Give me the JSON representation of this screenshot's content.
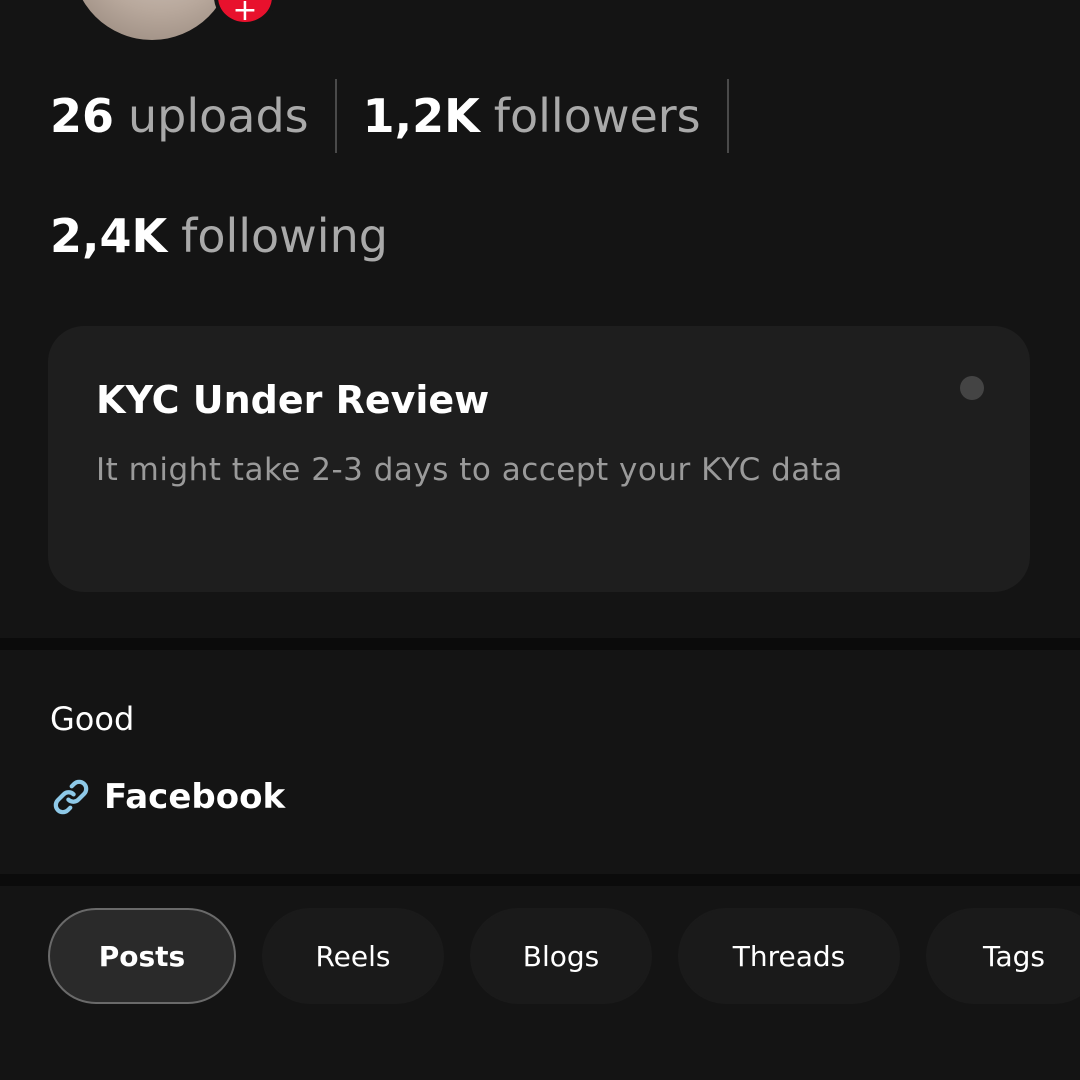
{
  "stats": {
    "uploads": {
      "value": "26",
      "label": "uploads"
    },
    "followers": {
      "value": "1,2K",
      "label": "followers"
    },
    "following": {
      "value": "2,4K",
      "label": "following"
    }
  },
  "kyc": {
    "title": "KYC Under Review",
    "description": "It might take 2-3 days to accept your KYC data"
  },
  "bio": {
    "text": "Good",
    "link_label": "Facebook",
    "link_icon": "link-icon"
  },
  "tabs": [
    {
      "label": "Posts",
      "active": true
    },
    {
      "label": "Reels",
      "active": false
    },
    {
      "label": "Blogs",
      "active": false
    },
    {
      "label": "Threads",
      "active": false
    },
    {
      "label": "Tags",
      "active": false
    }
  ],
  "colors": {
    "background": "#141414",
    "card": "#1e1e1e",
    "badge": "#e8112d",
    "muted_text": "#a9a9a9",
    "link_icon": "#8ec9e8"
  }
}
